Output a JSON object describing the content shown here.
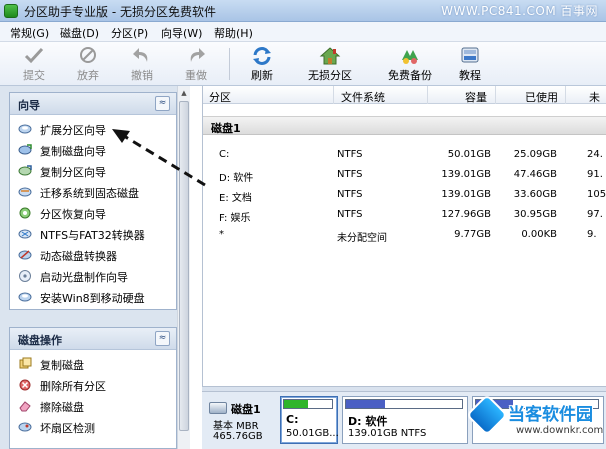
{
  "window": {
    "title": "分区助手专业版 - 无损分区免费软件",
    "watermark": "WWW.PC841.COM 百事网"
  },
  "menu": [
    {
      "label": "常规(G)"
    },
    {
      "label": "磁盘(D)"
    },
    {
      "label": "分区(P)"
    },
    {
      "label": "向导(W)"
    },
    {
      "label": "帮助(H)"
    }
  ],
  "toolbar": {
    "commit": "提交",
    "discard": "放弃",
    "undo": "撤销",
    "redo": "重做",
    "refresh": "刷新",
    "lossless": "无损分区",
    "free_backup": "免费备份",
    "tutorial": "教程"
  },
  "wizard_panel": {
    "title": "向导",
    "collapse_glyph": "≈",
    "items": [
      {
        "label": "扩展分区向导"
      },
      {
        "label": "复制磁盘向导"
      },
      {
        "label": "复制分区向导"
      },
      {
        "label": "迁移系统到固态磁盘"
      },
      {
        "label": "分区恢复向导"
      },
      {
        "label": "NTFS与FAT32转换器"
      },
      {
        "label": "动态磁盘转换器"
      },
      {
        "label": "启动光盘制作向导"
      },
      {
        "label": "安装Win8到移动硬盘"
      }
    ]
  },
  "disk_ops_panel": {
    "title": "磁盘操作",
    "collapse_glyph": "≈",
    "items": [
      {
        "label": "复制磁盘"
      },
      {
        "label": "删除所有分区"
      },
      {
        "label": "擦除磁盘"
      },
      {
        "label": "坏扇区检测"
      }
    ]
  },
  "table": {
    "headers": {
      "partition": "分区",
      "filesystem": "文件系统",
      "capacity": "容量",
      "used": "已使用",
      "free": "未"
    },
    "disk_group": "磁盘1",
    "rows": [
      {
        "name": "C:",
        "fs": "NTFS",
        "cap": "50.01GB",
        "used": "25.09GB",
        "free": "24."
      },
      {
        "name": "D: 软件",
        "fs": "NTFS",
        "cap": "139.01GB",
        "used": "47.46GB",
        "free": "91."
      },
      {
        "name": "E: 文档",
        "fs": "NTFS",
        "cap": "139.01GB",
        "used": "33.60GB",
        "free": "105."
      },
      {
        "name": "F: 娱乐",
        "fs": "NTFS",
        "cap": "127.96GB",
        "used": "30.95GB",
        "free": "97."
      },
      {
        "name": "*",
        "fs": "未分配空间",
        "cap": "9.77GB",
        "used": "0.00KB",
        "free": "9."
      }
    ]
  },
  "disk_map": {
    "disk_name": "磁盘1",
    "disk_type": "基本 MBR",
    "disk_size": "465.76GB",
    "partitions": [
      {
        "name": "C:",
        "size": "50.01GB...",
        "used_fraction": 0.5,
        "bar_color": "#2fb52c"
      },
      {
        "name": "D: 软件",
        "size": "139.01GB NTFS",
        "used_fraction": 0.34,
        "bar_color": "#4a5fc4"
      },
      {
        "name": "",
        "size": "",
        "used_fraction": 0.3,
        "bar_color": "#4a5fc4"
      }
    ]
  },
  "brand": {
    "name": "当客软件园",
    "url": "www.downkr.com"
  }
}
